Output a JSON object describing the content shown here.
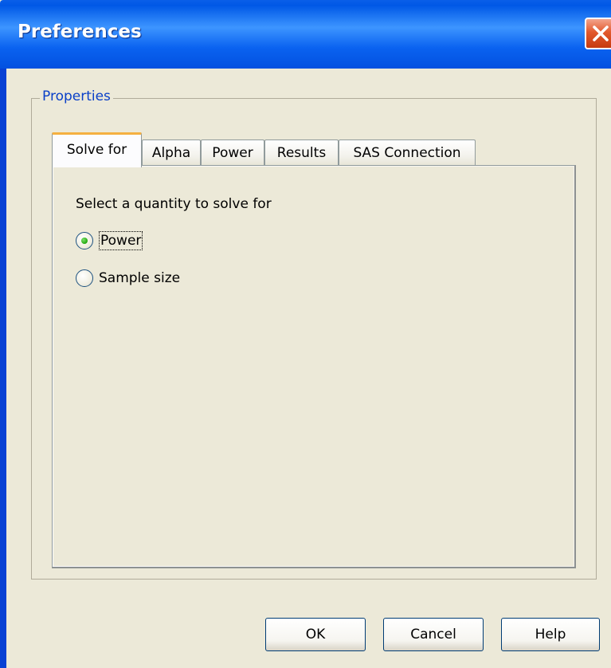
{
  "window": {
    "title": "Preferences"
  },
  "group": {
    "label": "Properties"
  },
  "tabs": [
    {
      "label": "Solve for",
      "active": true
    },
    {
      "label": "Alpha",
      "active": false
    },
    {
      "label": "Power",
      "active": false
    },
    {
      "label": "Results",
      "active": false
    },
    {
      "label": "SAS Connection",
      "active": false
    }
  ],
  "panel": {
    "prompt": "Select a quantity to solve for",
    "options": [
      {
        "label": "Power",
        "selected": true
      },
      {
        "label": "Sample size",
        "selected": false
      }
    ]
  },
  "buttons": {
    "ok": "OK",
    "cancel": "Cancel",
    "help": "Help"
  },
  "icons": {
    "close": "close-icon"
  },
  "colors": {
    "titlebar": "#0058e6",
    "background": "#ece9d8",
    "group_label": "#0a40c8",
    "active_tab_accent": "#f5b040",
    "close_button": "#e2592d",
    "radio_dot": "#22a80f"
  }
}
